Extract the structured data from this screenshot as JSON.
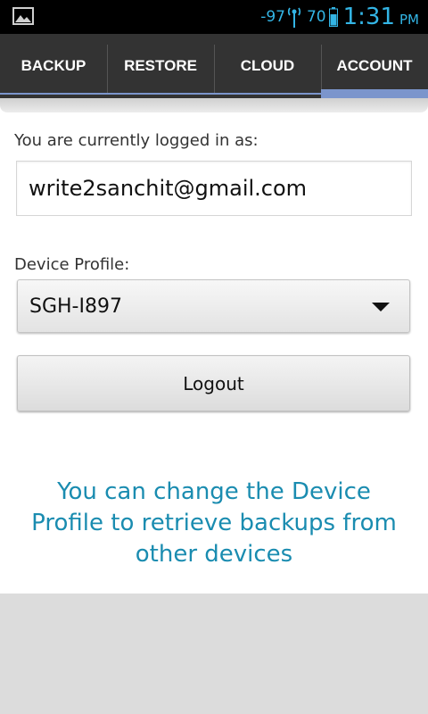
{
  "status_bar": {
    "signal_strength": "-97",
    "battery_level": "70",
    "time": "1:31",
    "ampm": "PM",
    "accent_color": "#33b5e5"
  },
  "tabs": [
    {
      "label": "BACKUP",
      "active": false
    },
    {
      "label": "RESTORE",
      "active": false
    },
    {
      "label": "CLOUD",
      "active": false
    },
    {
      "label": "ACCOUNT",
      "active": true
    }
  ],
  "account": {
    "logged_in_label": "You are currently logged in as:",
    "email": "write2sanchit@gmail.com",
    "device_profile_label": "Device Profile:",
    "device_profile_value": "SGH-I897",
    "logout_label": "Logout",
    "info_text": "You can change the Device Profile to retrieve backups from other devices"
  },
  "colors": {
    "tab_bar": "#333333",
    "tab_indicator": "#7b95cc",
    "info_text": "#1a8cb0"
  }
}
